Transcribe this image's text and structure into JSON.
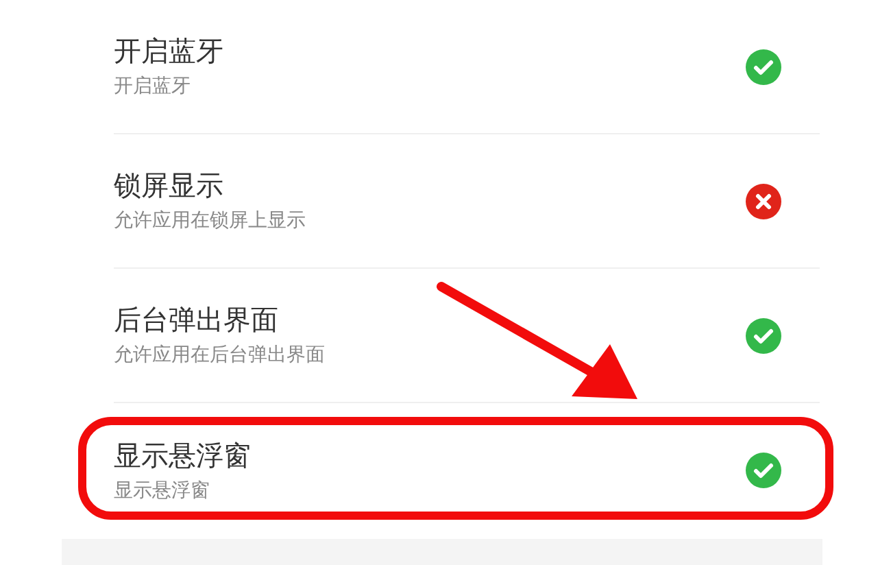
{
  "settings": [
    {
      "title": "开启蓝牙",
      "subtitle": "开启蓝牙",
      "allowed": true,
      "highlighted": false
    },
    {
      "title": "锁屏显示",
      "subtitle": "允许应用在锁屏上显示",
      "allowed": false,
      "highlighted": false
    },
    {
      "title": "后台弹出界面",
      "subtitle": "允许应用在后台弹出界面",
      "allowed": true,
      "highlighted": false
    },
    {
      "title": "显示悬浮窗",
      "subtitle": "显示悬浮窗",
      "allowed": true,
      "highlighted": true
    }
  ]
}
